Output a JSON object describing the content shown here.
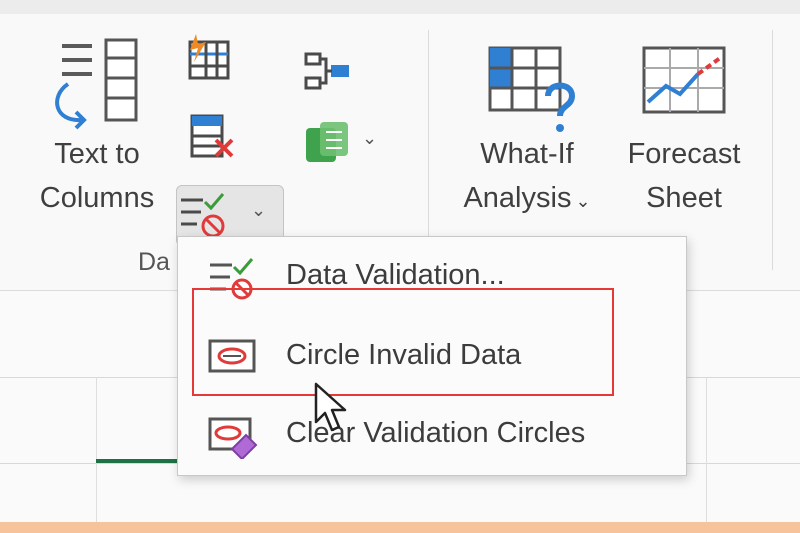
{
  "ribbon": {
    "text_to_columns": {
      "line1": "Text to",
      "line2": "Columns",
      "icon": "text-to-columns-icon"
    },
    "what_if": {
      "line1": "What-If",
      "line2": "Analysis",
      "chevron": "⌄",
      "icon": "what-if-analysis-icon"
    },
    "forecast": {
      "line1": "Forecast",
      "line2": "Sheet",
      "icon": "forecast-sheet-icon"
    },
    "group_label_partial": "Da",
    "small_icons": [
      "flash-fill-icon",
      "remove-duplicates-icon",
      "consolidate-icon",
      "relationships-icon",
      "data-model-icon"
    ],
    "data_validation_chevron": "⌄",
    "data_model_chevron": "⌄"
  },
  "menu": {
    "items": [
      {
        "label": "Data Validation...",
        "icon": "data-validation-icon"
      },
      {
        "label": "Circle Invalid Data",
        "icon": "circle-invalid-data-icon"
      },
      {
        "label": "Clear Validation Circles",
        "icon": "clear-validation-circles-icon"
      }
    ]
  },
  "colors": {
    "highlight": "#e53935",
    "accent_blue": "#2f7fd3",
    "accent_green": "#1e7145",
    "error_red": "#e03a3a"
  }
}
